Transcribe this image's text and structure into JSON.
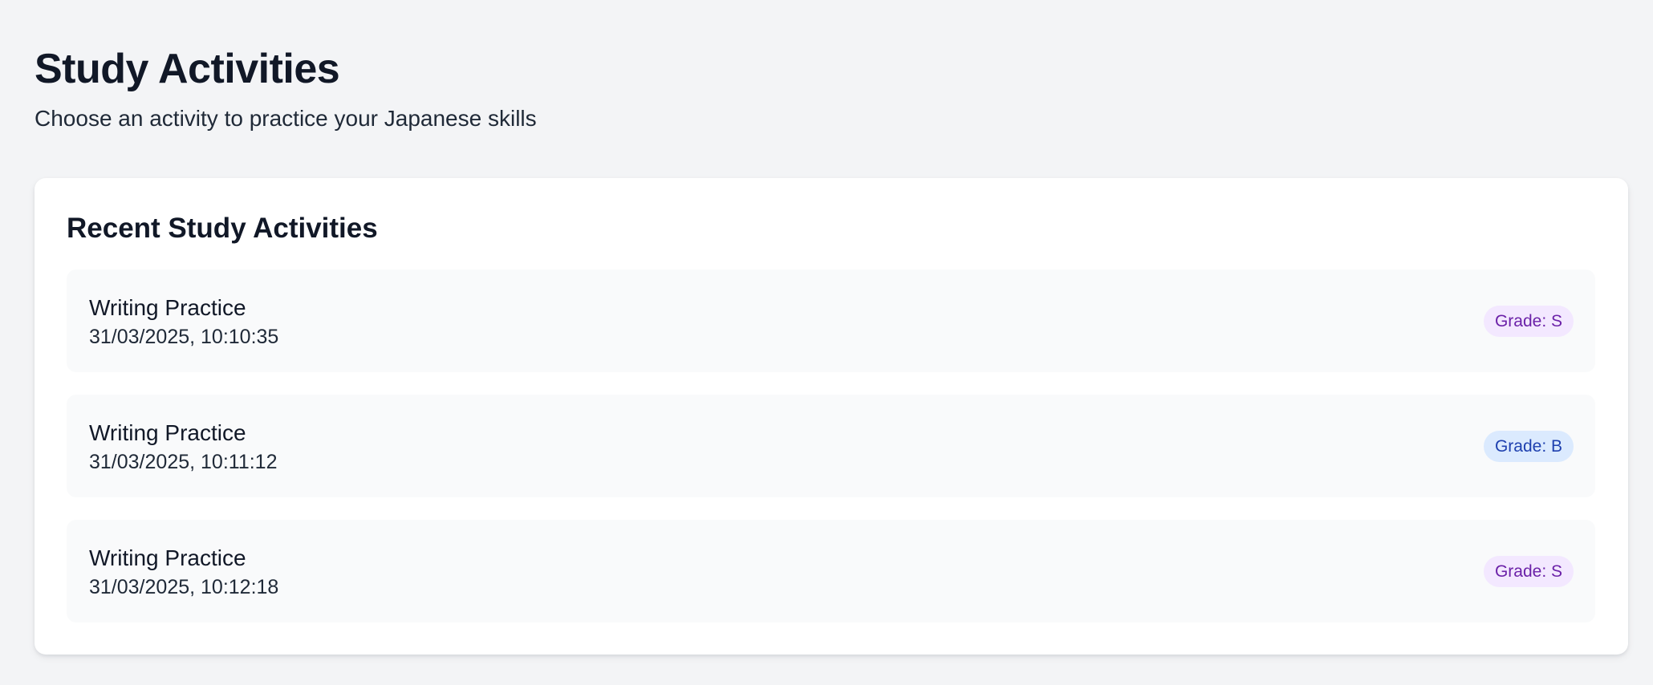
{
  "header": {
    "title": "Study Activities",
    "subtitle": "Choose an activity to practice your Japanese skills"
  },
  "recent": {
    "title": "Recent Study Activities",
    "items": [
      {
        "name": "Writing Practice",
        "timestamp": "31/03/2025, 10:10:35",
        "grade_label": "Grade: S",
        "badge_bg": "#f3e8ff",
        "badge_color": "#6b21a8"
      },
      {
        "name": "Writing Practice",
        "timestamp": "31/03/2025, 10:11:12",
        "grade_label": "Grade: B",
        "badge_bg": "#dbeafe",
        "badge_color": "#1e40af"
      },
      {
        "name": "Writing Practice",
        "timestamp": "31/03/2025, 10:12:18",
        "grade_label": "Grade: S",
        "badge_bg": "#f3e8ff",
        "badge_color": "#6b21a8"
      }
    ]
  }
}
